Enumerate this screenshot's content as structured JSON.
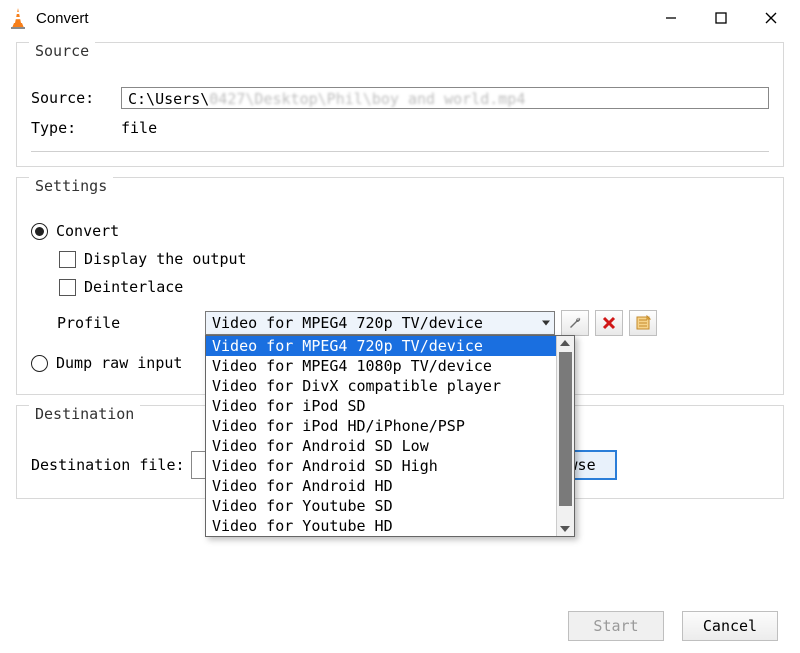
{
  "window": {
    "title": "Convert",
    "min_btn": "—",
    "max_btn": "☐",
    "close_btn": "✕"
  },
  "source_group": {
    "legend": "Source",
    "source_label": "Source:",
    "source_value_prefix": "C:\\Users\\",
    "source_value_blur": "0427\\Desktop\\Phil\\boy and world.mp4",
    "type_label": "Type:",
    "type_value": "file"
  },
  "settings_group": {
    "legend": "Settings",
    "convert_label": "Convert",
    "display_output": "Display the output",
    "deinterlace": "Deinterlace",
    "profile_label": "Profile",
    "profile_selected": "Video for MPEG4 720p TV/device",
    "profile_options": [
      "Video for MPEG4 720p TV/device",
      "Video for MPEG4 1080p TV/device",
      "Video for DivX compatible player",
      "Video for iPod SD",
      "Video for iPod HD/iPhone/PSP",
      "Video for Android SD Low",
      "Video for Android SD High",
      "Video for Android HD",
      "Video for Youtube SD",
      "Video for Youtube HD"
    ],
    "dump_label": "Dump raw input"
  },
  "destination_group": {
    "legend": "Destination",
    "dest_label": "Destination file:",
    "browse": "Browse"
  },
  "buttons": {
    "start": "Start",
    "cancel": "Cancel"
  },
  "icons": {
    "app": "vlc-cone-icon",
    "wrench": "wrench-icon",
    "delete": "delete-icon",
    "new": "new-profile-icon"
  }
}
